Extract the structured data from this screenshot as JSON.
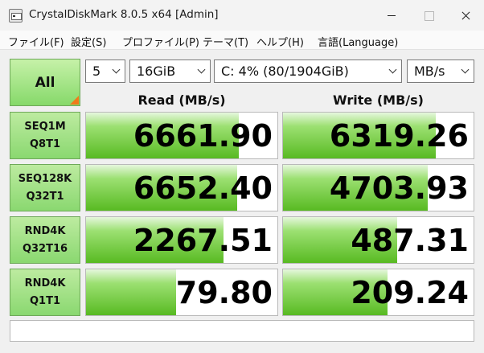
{
  "window": {
    "title": "CrystalDiskMark 8.0.5 x64 [Admin]"
  },
  "menu": [
    "ファイル(F)",
    "設定(S)",
    "プロファイル(P)",
    "テーマ(T)",
    "ヘルプ(H)",
    "言語(Language)"
  ],
  "controls": {
    "all_label": "All",
    "count": "5",
    "size": "16GiB",
    "drive": "C: 4% (80/1904GiB)",
    "unit": "MB/s"
  },
  "headers": {
    "read": "Read (MB/s)",
    "write": "Write (MB/s)"
  },
  "tests": [
    {
      "line1": "SEQ1M",
      "line2": "Q8T1",
      "read": "6661.90",
      "write": "6319.26",
      "read_level": 0.8,
      "write_level": 0.8
    },
    {
      "line1": "SEQ128K",
      "line2": "Q32T1",
      "read": "6652.40",
      "write": "4703.93",
      "read_level": 0.79,
      "write_level": 0.76
    },
    {
      "line1": "RND4K",
      "line2": "Q32T16",
      "read": "2267.51",
      "write": "487.31",
      "read_level": 0.72,
      "write_level": 0.6
    },
    {
      "line1": "RND4K",
      "line2": "Q1T1",
      "read": "79.80",
      "write": "209.24",
      "read_level": 0.47,
      "write_level": 0.55
    }
  ],
  "comment": "",
  "colors": {
    "accent_orange": "#f07a1a",
    "bar_green": "#58ba22",
    "label_green": "#8ad870"
  }
}
